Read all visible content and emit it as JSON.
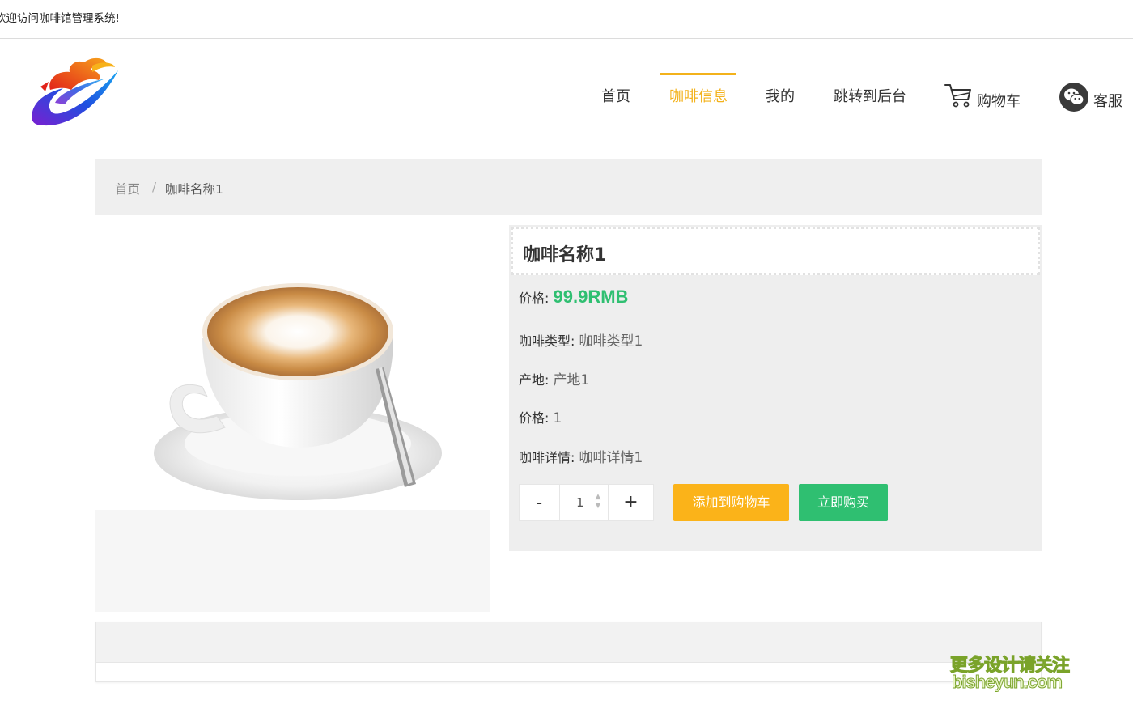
{
  "topbar": {
    "welcome": "欢迎访问咖啡馆管理系统!"
  },
  "nav": {
    "items": [
      "首页",
      "咖啡信息",
      "我的",
      "跳转到后台"
    ],
    "active_index": 1,
    "cart_label": "购物车",
    "service_label": "客服",
    "accent_color": "#f3b21b"
  },
  "breadcrumb": {
    "home": "首页",
    "separator": "/",
    "current": "咖啡名称1"
  },
  "product": {
    "name": "咖啡名称1",
    "price_label": "价格:",
    "price_value": "99.9RMB",
    "type_label": "咖啡类型:",
    "type_value": "咖啡类型1",
    "origin_label": "产地:",
    "origin_value": "产地1",
    "price2_label": "价格:",
    "price2_value": "1",
    "detail_label": "咖啡详情:",
    "detail_value": "咖啡详情1",
    "price_color": "#2fbf71"
  },
  "quantity": {
    "minus": "-",
    "value": "1",
    "plus": "+"
  },
  "actions": {
    "add_to_cart": "添加到购物车",
    "buy_now": "立即购买",
    "cart_color": "#fbb319",
    "buy_color": "#2fbf71"
  },
  "watermark": {
    "line1": "更多设计请关注",
    "line2": "bisheyun.com"
  }
}
